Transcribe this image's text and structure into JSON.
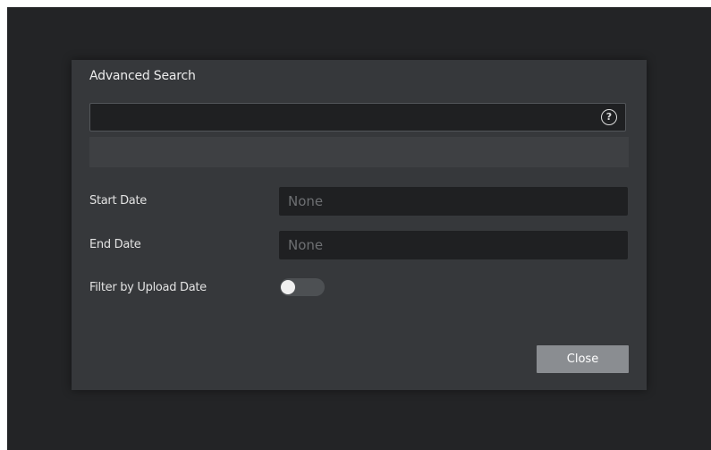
{
  "dialog": {
    "title": "Advanced Search"
  },
  "search": {
    "value": "",
    "help_icon_text": "?"
  },
  "fields": {
    "start_date_label": "Start Date",
    "start_date_placeholder": "None",
    "end_date_label": "End Date",
    "end_date_placeholder": "None",
    "upload_filter_label": "Filter by Upload Date",
    "upload_filter_enabled": false
  },
  "buttons": {
    "close_label": "Close"
  },
  "colors": {
    "backdrop": "#232426",
    "dialog": "#36383b",
    "input_bg": "#1f2022",
    "button_bg": "#8a8d91"
  }
}
